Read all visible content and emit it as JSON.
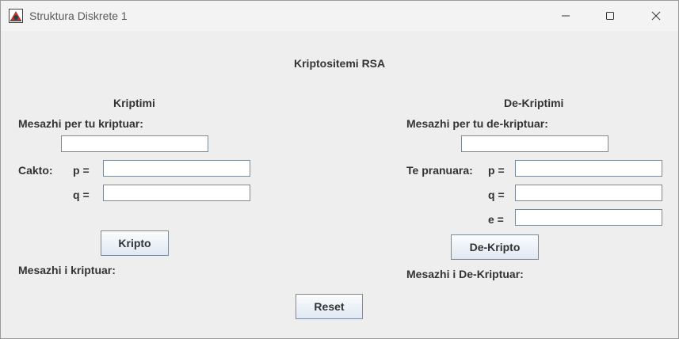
{
  "window": {
    "title": "Struktura Diskrete 1",
    "controls": [
      "minimize-icon",
      "maximize-icon",
      "close-icon"
    ]
  },
  "header": {
    "title": "Kriptositemi RSA"
  },
  "encrypt": {
    "section_title": "Kriptimi",
    "message_label": "Mesazhi per tu kriptuar:",
    "message_value": "",
    "set_label": "Cakto:",
    "p_label": "p =",
    "p_value": "",
    "q_label": "q =",
    "q_value": "",
    "button_label": "Kripto",
    "result_label": "Mesazhi i kriptuar:"
  },
  "decrypt": {
    "section_title": "De-Kriptimi",
    "message_label": "Mesazhi per tu de-kriptuar:",
    "message_value": "",
    "received_label": "Te pranuara:",
    "p_label": "p =",
    "p_value": "",
    "q_label": "q =",
    "q_value": "",
    "e_label": "e =",
    "e_value": "",
    "button_label": "De-Kripto",
    "result_label": "Mesazhi i De-Kriptuar:"
  },
  "reset": {
    "label": "Reset"
  }
}
